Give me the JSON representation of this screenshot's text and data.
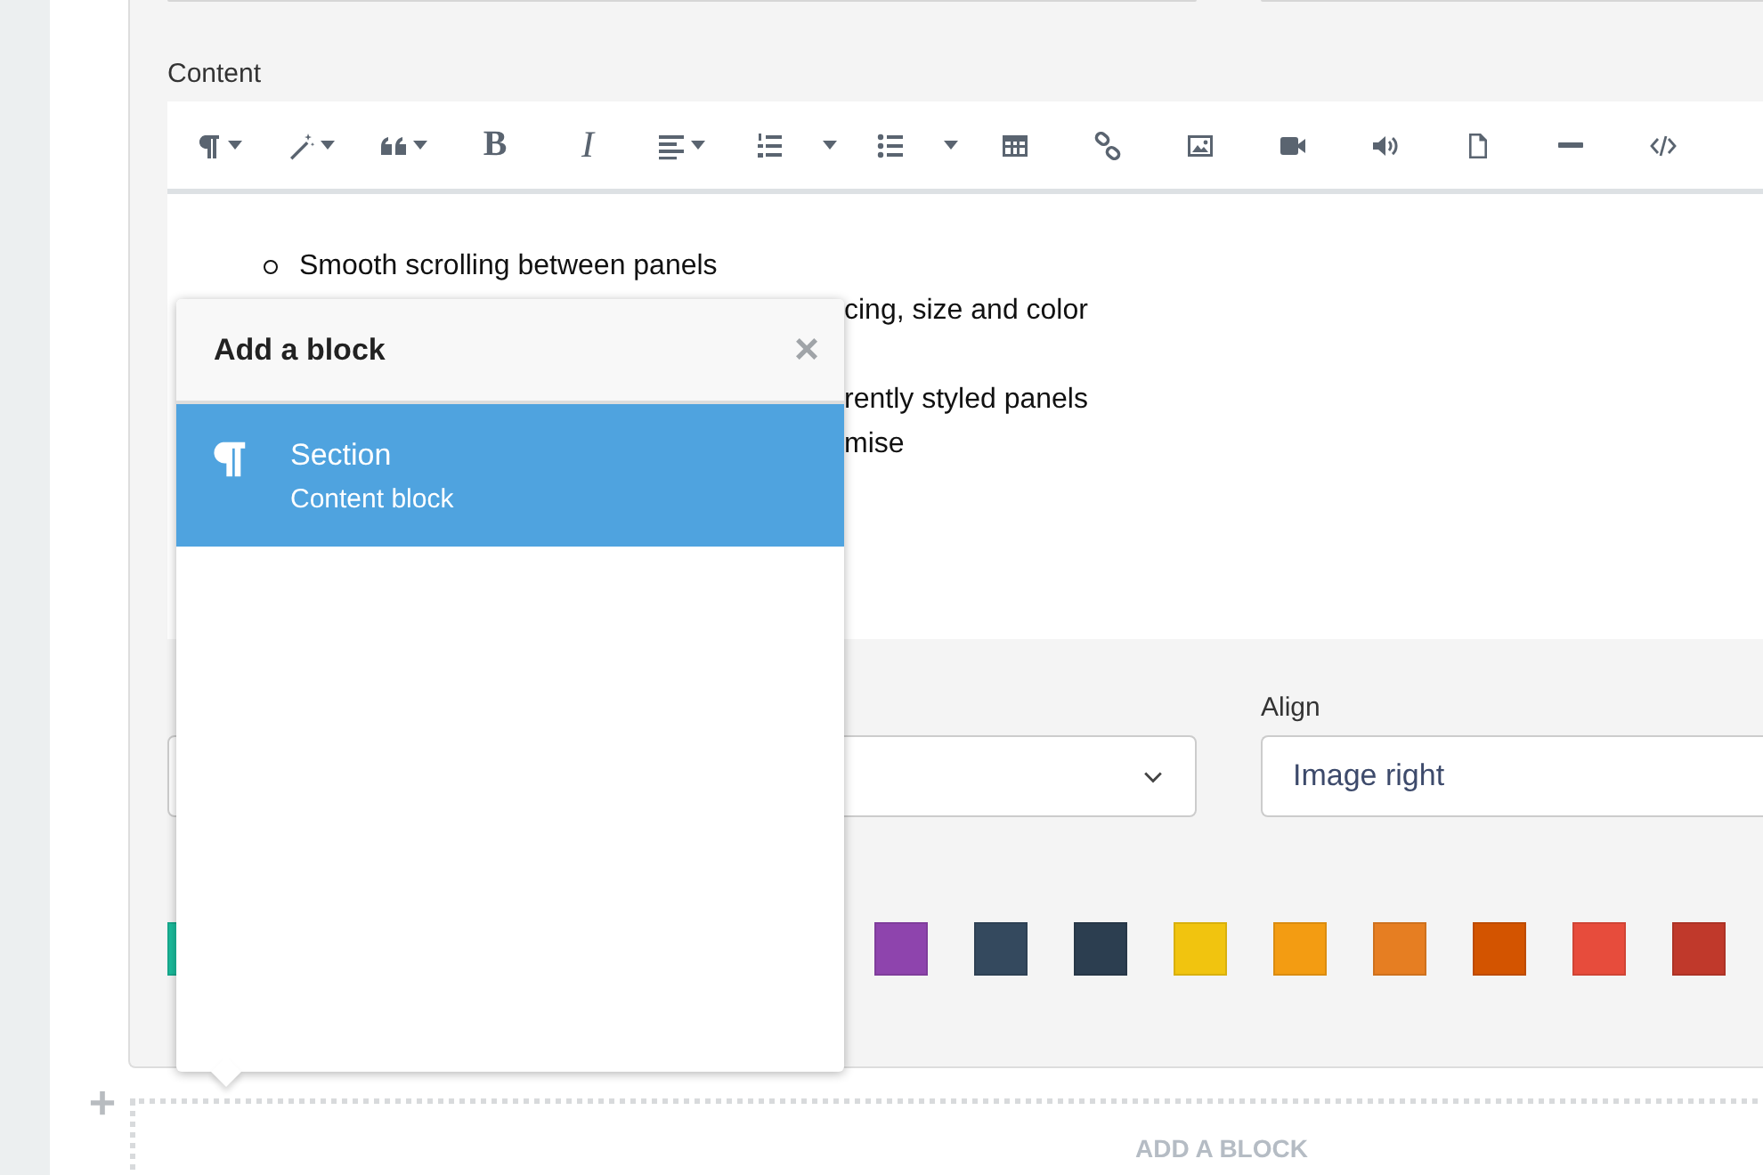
{
  "content_label": "Content",
  "toolbar": [
    {
      "kind": "paragraph",
      "caret": true
    },
    {
      "kind": "wand",
      "caret": true
    },
    {
      "kind": "quote",
      "caret": true
    },
    {
      "kind": "bold",
      "label": "B",
      "caret": false
    },
    {
      "kind": "italic",
      "label": "I",
      "caret": false
    },
    {
      "kind": "align",
      "caret": true
    },
    {
      "kind": "ordered-list",
      "caret": false
    },
    {
      "kind": "dropdown",
      "caret": true
    },
    {
      "kind": "bullet-list",
      "caret": false
    },
    {
      "kind": "dropdown",
      "caret": true
    },
    {
      "kind": "table",
      "caret": false
    },
    {
      "kind": "link",
      "caret": false
    },
    {
      "kind": "image",
      "caret": false
    },
    {
      "kind": "video",
      "caret": false
    },
    {
      "kind": "audio",
      "caret": false
    },
    {
      "kind": "file",
      "caret": false
    },
    {
      "kind": "rule",
      "caret": false
    },
    {
      "kind": "code",
      "caret": false
    }
  ],
  "editor_lines": [
    {
      "kind": "bullet",
      "text": "Smooth scrolling between panels"
    },
    {
      "kind": "covered",
      "text": "cing, size and color"
    },
    {
      "kind": "gap"
    },
    {
      "kind": "covered",
      "text": "rently styled panels"
    },
    {
      "kind": "covered",
      "text": "mise"
    }
  ],
  "align": {
    "label": "Align",
    "value": "Image right"
  },
  "swatches": [
    {
      "color": "#1abc9c"
    },
    {
      "color": "#8e44ad"
    },
    {
      "color": "#34495e"
    },
    {
      "color": "#2c3e50"
    },
    {
      "color": "#f1c40f"
    },
    {
      "color": "#f39c12"
    },
    {
      "color": "#e67e22"
    },
    {
      "color": "#d35400"
    },
    {
      "color": "#e74c3c"
    },
    {
      "color": "#c0392b"
    }
  ],
  "popup": {
    "title": "Add a block",
    "close": "×",
    "items": [
      {
        "title": "Section",
        "subtitle": "Content block",
        "selected": true
      }
    ]
  },
  "add_block": "ADD A BLOCK"
}
